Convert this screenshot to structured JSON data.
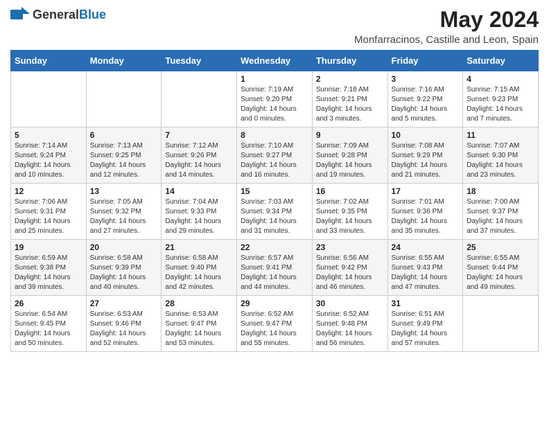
{
  "header": {
    "logo_general": "General",
    "logo_blue": "Blue",
    "title": "May 2024",
    "subtitle": "Monfarracinos, Castille and Leon, Spain"
  },
  "calendar": {
    "days_of_week": [
      "Sunday",
      "Monday",
      "Tuesday",
      "Wednesday",
      "Thursday",
      "Friday",
      "Saturday"
    ],
    "weeks": [
      [
        {
          "day": "",
          "info": ""
        },
        {
          "day": "",
          "info": ""
        },
        {
          "day": "",
          "info": ""
        },
        {
          "day": "1",
          "info": "Sunrise: 7:19 AM\nSunset: 9:20 PM\nDaylight: 14 hours\nand 0 minutes."
        },
        {
          "day": "2",
          "info": "Sunrise: 7:18 AM\nSunset: 9:21 PM\nDaylight: 14 hours\nand 3 minutes."
        },
        {
          "day": "3",
          "info": "Sunrise: 7:16 AM\nSunset: 9:22 PM\nDaylight: 14 hours\nand 5 minutes."
        },
        {
          "day": "4",
          "info": "Sunrise: 7:15 AM\nSunset: 9:23 PM\nDaylight: 14 hours\nand 7 minutes."
        }
      ],
      [
        {
          "day": "5",
          "info": "Sunrise: 7:14 AM\nSunset: 9:24 PM\nDaylight: 14 hours\nand 10 minutes."
        },
        {
          "day": "6",
          "info": "Sunrise: 7:13 AM\nSunset: 9:25 PM\nDaylight: 14 hours\nand 12 minutes."
        },
        {
          "day": "7",
          "info": "Sunrise: 7:12 AM\nSunset: 9:26 PM\nDaylight: 14 hours\nand 14 minutes."
        },
        {
          "day": "8",
          "info": "Sunrise: 7:10 AM\nSunset: 9:27 PM\nDaylight: 14 hours\nand 16 minutes."
        },
        {
          "day": "9",
          "info": "Sunrise: 7:09 AM\nSunset: 9:28 PM\nDaylight: 14 hours\nand 19 minutes."
        },
        {
          "day": "10",
          "info": "Sunrise: 7:08 AM\nSunset: 9:29 PM\nDaylight: 14 hours\nand 21 minutes."
        },
        {
          "day": "11",
          "info": "Sunrise: 7:07 AM\nSunset: 9:30 PM\nDaylight: 14 hours\nand 23 minutes."
        }
      ],
      [
        {
          "day": "12",
          "info": "Sunrise: 7:06 AM\nSunset: 9:31 PM\nDaylight: 14 hours\nand 25 minutes."
        },
        {
          "day": "13",
          "info": "Sunrise: 7:05 AM\nSunset: 9:32 PM\nDaylight: 14 hours\nand 27 minutes."
        },
        {
          "day": "14",
          "info": "Sunrise: 7:04 AM\nSunset: 9:33 PM\nDaylight: 14 hours\nand 29 minutes."
        },
        {
          "day": "15",
          "info": "Sunrise: 7:03 AM\nSunset: 9:34 PM\nDaylight: 14 hours\nand 31 minutes."
        },
        {
          "day": "16",
          "info": "Sunrise: 7:02 AM\nSunset: 9:35 PM\nDaylight: 14 hours\nand 33 minutes."
        },
        {
          "day": "17",
          "info": "Sunrise: 7:01 AM\nSunset: 9:36 PM\nDaylight: 14 hours\nand 35 minutes."
        },
        {
          "day": "18",
          "info": "Sunrise: 7:00 AM\nSunset: 9:37 PM\nDaylight: 14 hours\nand 37 minutes."
        }
      ],
      [
        {
          "day": "19",
          "info": "Sunrise: 6:59 AM\nSunset: 9:38 PM\nDaylight: 14 hours\nand 39 minutes."
        },
        {
          "day": "20",
          "info": "Sunrise: 6:58 AM\nSunset: 9:39 PM\nDaylight: 14 hours\nand 40 minutes."
        },
        {
          "day": "21",
          "info": "Sunrise: 6:58 AM\nSunset: 9:40 PM\nDaylight: 14 hours\nand 42 minutes."
        },
        {
          "day": "22",
          "info": "Sunrise: 6:57 AM\nSunset: 9:41 PM\nDaylight: 14 hours\nand 44 minutes."
        },
        {
          "day": "23",
          "info": "Sunrise: 6:56 AM\nSunset: 9:42 PM\nDaylight: 14 hours\nand 46 minutes."
        },
        {
          "day": "24",
          "info": "Sunrise: 6:55 AM\nSunset: 9:43 PM\nDaylight: 14 hours\nand 47 minutes."
        },
        {
          "day": "25",
          "info": "Sunrise: 6:55 AM\nSunset: 9:44 PM\nDaylight: 14 hours\nand 49 minutes."
        }
      ],
      [
        {
          "day": "26",
          "info": "Sunrise: 6:54 AM\nSunset: 9:45 PM\nDaylight: 14 hours\nand 50 minutes."
        },
        {
          "day": "27",
          "info": "Sunrise: 6:53 AM\nSunset: 9:46 PM\nDaylight: 14 hours\nand 52 minutes."
        },
        {
          "day": "28",
          "info": "Sunrise: 6:53 AM\nSunset: 9:47 PM\nDaylight: 14 hours\nand 53 minutes."
        },
        {
          "day": "29",
          "info": "Sunrise: 6:52 AM\nSunset: 9:47 PM\nDaylight: 14 hours\nand 55 minutes."
        },
        {
          "day": "30",
          "info": "Sunrise: 6:52 AM\nSunset: 9:48 PM\nDaylight: 14 hours\nand 56 minutes."
        },
        {
          "day": "31",
          "info": "Sunrise: 6:51 AM\nSunset: 9:49 PM\nDaylight: 14 hours\nand 57 minutes."
        },
        {
          "day": "",
          "info": ""
        }
      ]
    ]
  }
}
